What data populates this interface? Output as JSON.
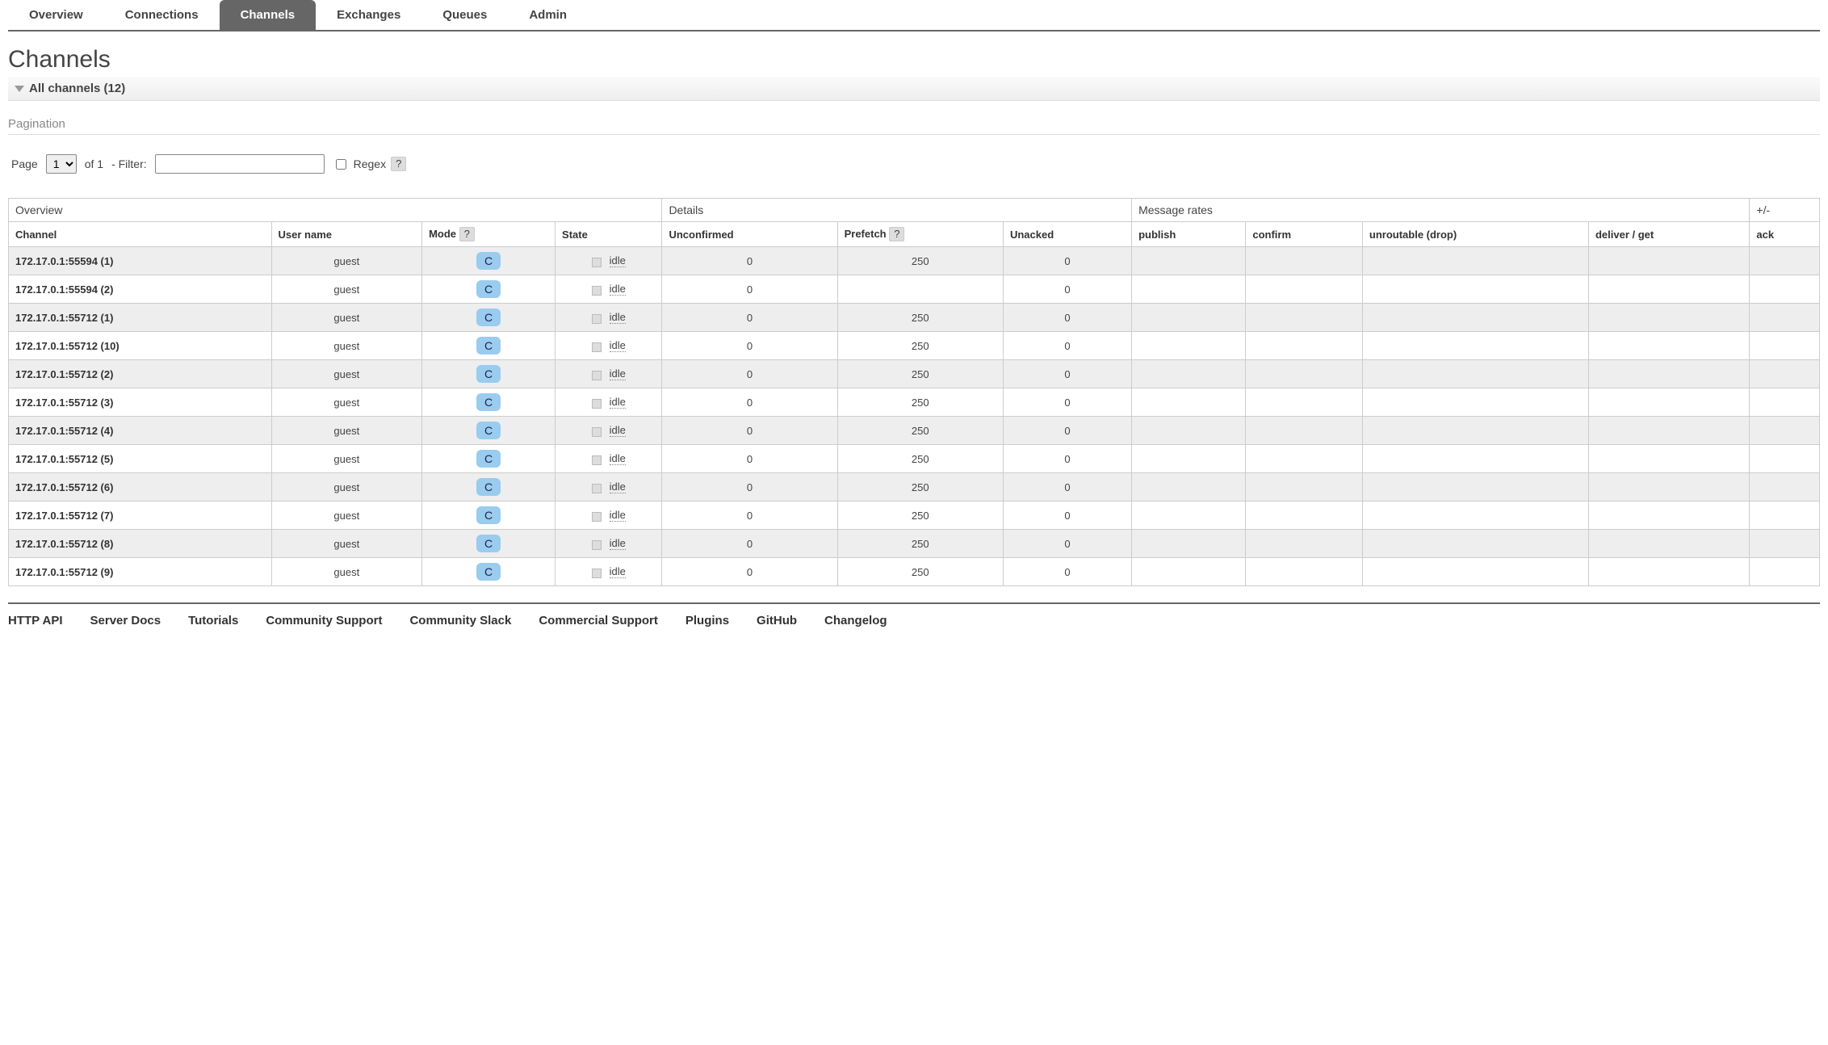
{
  "nav": {
    "tabs": [
      {
        "label": "Overview"
      },
      {
        "label": "Connections"
      },
      {
        "label": "Channels",
        "active": true
      },
      {
        "label": "Exchanges"
      },
      {
        "label": "Queues"
      },
      {
        "label": "Admin"
      }
    ]
  },
  "page": {
    "title": "Channels",
    "all_channels_header": "All channels (12)"
  },
  "pagination": {
    "section_label": "Pagination",
    "page_label": "Page",
    "page_selected": "1",
    "page_options": [
      "1"
    ],
    "of_text": "of 1",
    "filter_label": "- Filter:",
    "filter_value": "",
    "regex_label": "Regex",
    "help": "?"
  },
  "table": {
    "group_headers": {
      "overview": "Overview",
      "details": "Details",
      "rates": "Message rates",
      "toggle": "+/-"
    },
    "columns": {
      "channel": "Channel",
      "user": "User name",
      "mode": "Mode",
      "mode_help": "?",
      "state": "State",
      "unconfirmed": "Unconfirmed",
      "prefetch": "Prefetch",
      "prefetch_help": "?",
      "unacked": "Unacked",
      "publish": "publish",
      "confirm": "confirm",
      "unroutable": "unroutable (drop)",
      "deliver": "deliver / get",
      "ack": "ack"
    },
    "rows": [
      {
        "channel": "172.17.0.1:55594 (1)",
        "user": "guest",
        "mode": "C",
        "state": "idle",
        "unconfirmed": "0",
        "prefetch": "250",
        "unacked": "0"
      },
      {
        "channel": "172.17.0.1:55594 (2)",
        "user": "guest",
        "mode": "C",
        "state": "idle",
        "unconfirmed": "0",
        "prefetch": "",
        "unacked": "0"
      },
      {
        "channel": "172.17.0.1:55712 (1)",
        "user": "guest",
        "mode": "C",
        "state": "idle",
        "unconfirmed": "0",
        "prefetch": "250",
        "unacked": "0"
      },
      {
        "channel": "172.17.0.1:55712 (10)",
        "user": "guest",
        "mode": "C",
        "state": "idle",
        "unconfirmed": "0",
        "prefetch": "250",
        "unacked": "0"
      },
      {
        "channel": "172.17.0.1:55712 (2)",
        "user": "guest",
        "mode": "C",
        "state": "idle",
        "unconfirmed": "0",
        "prefetch": "250",
        "unacked": "0"
      },
      {
        "channel": "172.17.0.1:55712 (3)",
        "user": "guest",
        "mode": "C",
        "state": "idle",
        "unconfirmed": "0",
        "prefetch": "250",
        "unacked": "0"
      },
      {
        "channel": "172.17.0.1:55712 (4)",
        "user": "guest",
        "mode": "C",
        "state": "idle",
        "unconfirmed": "0",
        "prefetch": "250",
        "unacked": "0"
      },
      {
        "channel": "172.17.0.1:55712 (5)",
        "user": "guest",
        "mode": "C",
        "state": "idle",
        "unconfirmed": "0",
        "prefetch": "250",
        "unacked": "0"
      },
      {
        "channel": "172.17.0.1:55712 (6)",
        "user": "guest",
        "mode": "C",
        "state": "idle",
        "unconfirmed": "0",
        "prefetch": "250",
        "unacked": "0"
      },
      {
        "channel": "172.17.0.1:55712 (7)",
        "user": "guest",
        "mode": "C",
        "state": "idle",
        "unconfirmed": "0",
        "prefetch": "250",
        "unacked": "0"
      },
      {
        "channel": "172.17.0.1:55712 (8)",
        "user": "guest",
        "mode": "C",
        "state": "idle",
        "unconfirmed": "0",
        "prefetch": "250",
        "unacked": "0"
      },
      {
        "channel": "172.17.0.1:55712 (9)",
        "user": "guest",
        "mode": "C",
        "state": "idle",
        "unconfirmed": "0",
        "prefetch": "250",
        "unacked": "0"
      }
    ]
  },
  "footer": {
    "links": [
      {
        "label": "HTTP API"
      },
      {
        "label": "Server Docs"
      },
      {
        "label": "Tutorials"
      },
      {
        "label": "Community Support"
      },
      {
        "label": "Community Slack"
      },
      {
        "label": "Commercial Support"
      },
      {
        "label": "Plugins"
      },
      {
        "label": "GitHub"
      },
      {
        "label": "Changelog"
      }
    ]
  }
}
